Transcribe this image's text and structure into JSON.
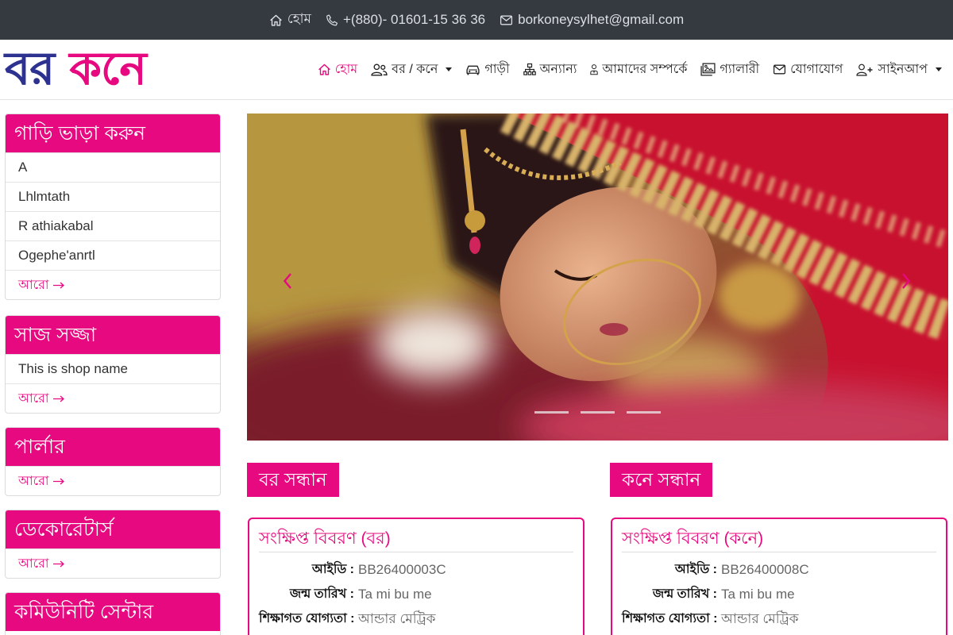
{
  "colors": {
    "accent": "#e6097f",
    "brand_blue": "#2d318f",
    "topbar_bg": "#343a40"
  },
  "topbar": {
    "home": {
      "icon": "home-icon",
      "label": "হোম"
    },
    "phone": {
      "icon": "phone-icon",
      "label": "+(880)- 01601-15 36 36"
    },
    "email": {
      "icon": "envelope-icon",
      "label": "borkoneysylhet@gmail.com"
    }
  },
  "brand": {
    "groom_word": "বর",
    "bride_word": "কনে"
  },
  "nav": {
    "items": [
      {
        "label": "হোম",
        "icon": "home-icon",
        "active": true
      },
      {
        "label": "বর / কনে",
        "icon": "users-icon",
        "dropdown": true
      },
      {
        "label": "গাড়ী",
        "icon": "car-icon"
      },
      {
        "label": "অন্যান্য",
        "icon": "sitemap-icon"
      },
      {
        "label": "আমাদের সম্পর্কে",
        "icon": "user-tie-icon"
      },
      {
        "label": "গ্যালারী",
        "icon": "images-icon"
      },
      {
        "label": "যোগাযোগ",
        "icon": "envelope-icon"
      },
      {
        "label": "সাইনআপ",
        "icon": "user-plus-icon",
        "dropdown": true
      }
    ]
  },
  "sidebar": {
    "more_icon": "arrow-right-icon",
    "cards": [
      {
        "title": "গাড়ি ভাড়া করুন",
        "items": [
          "A",
          "Lhlmtath",
          "R athiakabal",
          "Ogephe'anrtl"
        ],
        "more": "আরো"
      },
      {
        "title": "সাজ সজ্জা",
        "items": [
          "This is shop name"
        ],
        "more": "আরো"
      },
      {
        "title": "পার্লার",
        "items": [],
        "more": "আরো"
      },
      {
        "title": "ডেকোরেটার্স",
        "items": [],
        "more": "আরো"
      },
      {
        "title": "কমিউনিটি সেন্টার",
        "items": []
      }
    ]
  },
  "carousel": {
    "indicator_count": 3,
    "prev_icon": "chevron-left-icon",
    "next_icon": "chevron-right-icon"
  },
  "search": {
    "groom": "বর সন্ধান",
    "bride": "কনে সন্ধান"
  },
  "profiles": [
    {
      "title": "সংক্ষিপ্ত বিবরণ (বর)",
      "fields": [
        {
          "label": "আইডি :",
          "value": "BB26400003C"
        },
        {
          "label": "জন্ম তারিখ :",
          "value": "Ta mi bu me"
        },
        {
          "label": "শিক্ষাগত যোগ্যতা :",
          "value": "আন্ডার মেট্রিক"
        }
      ]
    },
    {
      "title": "সংক্ষিপ্ত বিবরণ (কনে)",
      "fields": [
        {
          "label": "আইডি :",
          "value": "BB26400008C"
        },
        {
          "label": "জন্ম তারিখ :",
          "value": "Ta mi bu me"
        },
        {
          "label": "শিক্ষাগত যোগ্যতা :",
          "value": "আন্ডার মেট্রিক"
        }
      ]
    }
  ]
}
